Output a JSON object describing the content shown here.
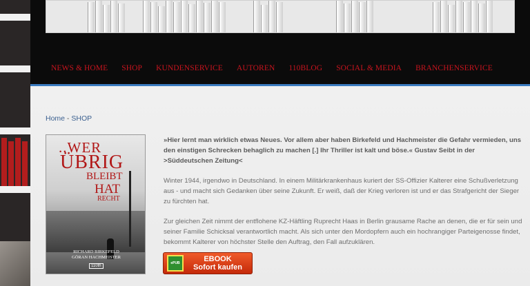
{
  "nav": {
    "items": [
      "NEWS & HOME",
      "SHOP",
      "KUNDENSERVICE",
      "AUTOREN",
      "110BLOG",
      "SOCIAL & MEDIA",
      "BRANCHENSERVICE"
    ]
  },
  "breadcrumb": {
    "home": "Home",
    "separator": " - ",
    "current": "SHOP"
  },
  "book": {
    "cover": {
      "title_line1": "..WER",
      "title_line2": "ÜBRIG",
      "title_line3": "BLEIBT",
      "title_line4": "HAT",
      "title_line5": "RECHT",
      "author1": "RICHARD BIRKEFELD",
      "author2": "GÖRAN HACHMEISTER",
      "publisher": "110th"
    },
    "quote": "»Hier lernt man wirklich etwas Neues. Vor allem aber haben Birkefeld und Hachmeister die Gefahr vermieden, uns den einstigen Schrecken behaglich zu machen [.] Ihr Thriller ist kalt und böse.« Gustav Seibt in der >Süddeutschen Zeitung<",
    "paragraph1": "Winter 1944, irgendwo in Deutschland. In einem Militärkrankenhaus kuriert der SS-Offizier Kalterer eine Schußverletzung aus - und macht sich Gedanken über seine Zukunft. Er weiß, daß der Krieg verloren ist und er das Strafgericht der Sieger zu fürchten hat.",
    "paragraph2": "Zur gleichen Zeit nimmt der entflohene KZ-Häftling Ruprecht Haas in Berlin grausame Rache an denen, die er für sein und seiner Familie Schicksal verantwortlich macht. Als sich unter den Mordopfern auch ein hochrangiger Parteigenosse findet, bekommt Kalterer von höchster Stelle den Auftrag, den Fall aufzuklären."
  },
  "ebook_button": {
    "icon_label": "ePUB",
    "line1": "EBOOK",
    "line2": "Sofort kaufen"
  },
  "colors": {
    "nav_text": "#c8141e",
    "header_bg": "#0b0b0b",
    "accent_border": "#3a7bbf",
    "link": "#3a5f8f",
    "button_bg": "#e04a1e"
  }
}
